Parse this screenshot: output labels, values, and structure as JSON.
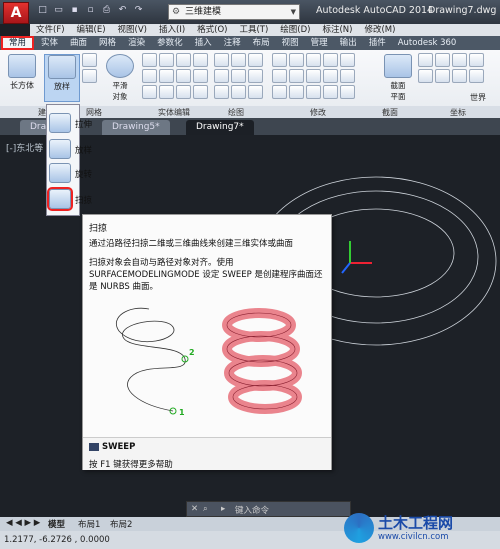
{
  "titlebar": {
    "workspace": "三维建模",
    "app_title": "Autodesk AutoCAD 2014",
    "document": "Drawing7.dwg"
  },
  "menubar": [
    "文件(F)",
    "编辑(E)",
    "视图(V)",
    "插入(I)",
    "格式(O)",
    "工具(T)",
    "绘图(D)",
    "标注(N)",
    "修改(M)"
  ],
  "ribbon_tabs": [
    "常用",
    "实体",
    "曲面",
    "网格",
    "渲染",
    "参数化",
    "插入",
    "注释",
    "布局",
    "视图",
    "管理",
    "输出",
    "插件",
    "Autodesk 360",
    "精选"
  ],
  "ribbon": {
    "box_label": "长方体",
    "sweep_label": "放样",
    "smooth_label": "平滑\n对象",
    "section_label": "截面\n平面",
    "world_label": "世界",
    "panel_labels": [
      "建",
      "网格",
      "实体编辑",
      "绘图",
      "修改",
      "截面",
      "坐标"
    ]
  },
  "doc_tabs": [
    "Drawing",
    "Drawing5*",
    "Drawing7*"
  ],
  "view_label": "[-]东北等",
  "dropdown": {
    "items": [
      "拉伸",
      "放样",
      "旋转",
      "扫掠"
    ]
  },
  "tooltip": {
    "title": "扫掠",
    "description": "通过沿路径扫掠二维或三维曲线来创建三维实体或曲面",
    "body": "扫掠对象会自动与路径对象对齐。使用 SURFACEMODELINGMODE 设定 SWEEP 是创建程序曲面还是 NURBS 曲面。",
    "illus_label_1": "1",
    "illus_label_2": "2",
    "command": "SWEEP",
    "help": "按 F1 键获得更多帮助"
  },
  "cmdbar": {
    "placeholder": "键入命令"
  },
  "layout_tabs": [
    "模型",
    "布局1",
    "布局2"
  ],
  "status": {
    "coords": "1.2177,   -6.2726 , 0.0000"
  },
  "watermark": {
    "name": "土木工程网",
    "url": "www.civilcn.com"
  },
  "colors": {
    "highlight": "#e22222",
    "canvas": "#1d2127",
    "helix": "#cfd5dc",
    "tube": "#e8707a"
  }
}
